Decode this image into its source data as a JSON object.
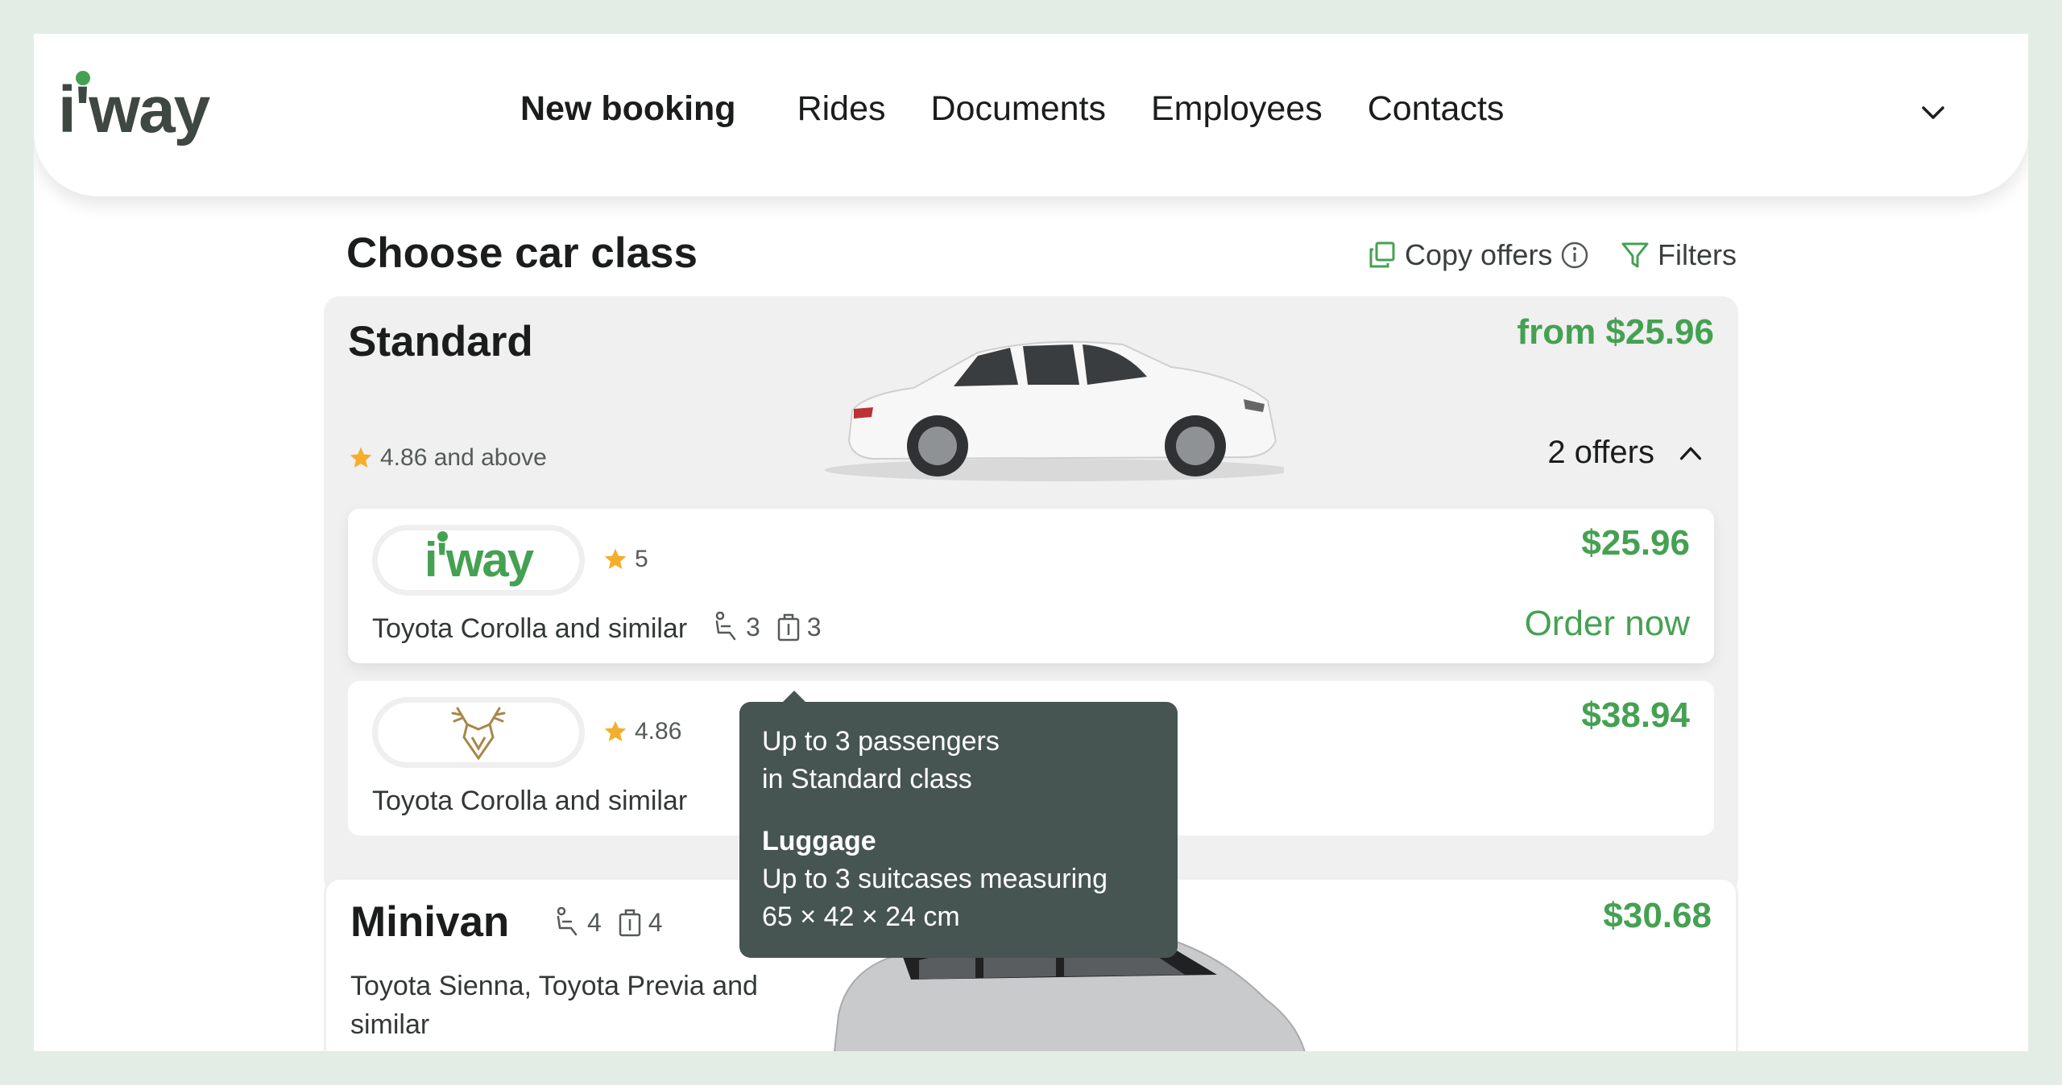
{
  "brand": {
    "logo_text": "i'way",
    "accent": "#45a152",
    "dark": "#3f4742"
  },
  "nav": {
    "items": [
      "New booking",
      "Rides",
      "Documents",
      "Employees",
      "Contacts"
    ],
    "active": "New booking"
  },
  "page": {
    "title": "Choose car class",
    "copy_offers_label": "Copy offers",
    "filters_label": "Filters"
  },
  "standard": {
    "name": "Standard",
    "price": "from $25.96",
    "rating": "4.86 and above",
    "offers_count": "2 offers",
    "offers": [
      {
        "provider_logo": "i'way",
        "rating": "5",
        "model": "Toyota Corolla and similar",
        "passengers": "3",
        "luggage": "3",
        "price": "$25.96",
        "action": "Order now"
      },
      {
        "provider_logo": "deer-crest-logo",
        "rating": "4.86",
        "model": "Toyota Corolla and similar",
        "price": "$38.94"
      }
    ]
  },
  "minivan": {
    "name": "Minivan",
    "passengers": "4",
    "luggage": "4",
    "models": "Toyota Sienna, Toyota Previa and similar",
    "price": "$30.68"
  },
  "tooltip": {
    "passengers_line1": "Up to 3 passengers",
    "passengers_line2": "in Standard class",
    "luggage_title": "Luggage",
    "luggage_line1": "Up to 3 suitcases measuring",
    "luggage_line2": "65 × 42 × 24 cm"
  },
  "icons": {
    "star": "star-icon",
    "seat": "seat-icon",
    "luggage": "suitcase-icon",
    "copy": "copy-icon",
    "info": "info-icon",
    "filter": "filter-icon",
    "chevron_down": "chevron-down-icon",
    "chevron_up": "chevron-up-icon"
  }
}
